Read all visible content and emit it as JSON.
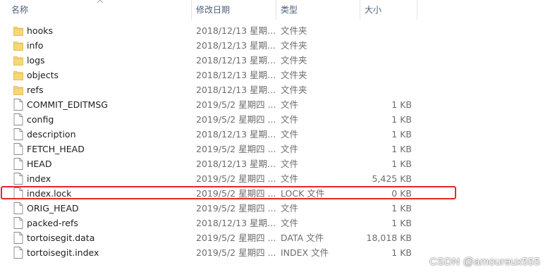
{
  "columns": {
    "name": "名称",
    "date": "修改日期",
    "type": "类型",
    "size": "大小"
  },
  "sort_indicator": "chevron-up-icon",
  "files": [
    {
      "name": "hooks",
      "date": "2018/12/13 星期...",
      "type": "文件夹",
      "size": "",
      "kind": "folder"
    },
    {
      "name": "info",
      "date": "2018/12/13 星期...",
      "type": "文件夹",
      "size": "",
      "kind": "folder"
    },
    {
      "name": "logs",
      "date": "2018/12/13 星期...",
      "type": "文件夹",
      "size": "",
      "kind": "folder"
    },
    {
      "name": "objects",
      "date": "2018/12/13 星期...",
      "type": "文件夹",
      "size": "",
      "kind": "folder"
    },
    {
      "name": "refs",
      "date": "2018/12/13 星期...",
      "type": "文件夹",
      "size": "",
      "kind": "folder"
    },
    {
      "name": "COMMIT_EDITMSG",
      "date": "2019/5/2 星期四 ...",
      "type": "文件",
      "size": "1 KB",
      "kind": "file"
    },
    {
      "name": "config",
      "date": "2019/5/2 星期四 ...",
      "type": "文件",
      "size": "1 KB",
      "kind": "file"
    },
    {
      "name": "description",
      "date": "2018/12/13 星期...",
      "type": "文件",
      "size": "1 KB",
      "kind": "file"
    },
    {
      "name": "FETCH_HEAD",
      "date": "2019/5/2 星期四 ...",
      "type": "文件",
      "size": "1 KB",
      "kind": "file"
    },
    {
      "name": "HEAD",
      "date": "2018/12/13 星期...",
      "type": "文件",
      "size": "1 KB",
      "kind": "file"
    },
    {
      "name": "index",
      "date": "2019/5/2 星期四 ...",
      "type": "文件",
      "size": "5,425 KB",
      "kind": "file"
    },
    {
      "name": "index.lock",
      "date": "2019/5/2 星期四 ...",
      "type": "LOCK 文件",
      "size": "0 KB",
      "kind": "file"
    },
    {
      "name": "ORIG_HEAD",
      "date": "2019/5/2 星期四 ...",
      "type": "文件",
      "size": "1 KB",
      "kind": "file"
    },
    {
      "name": "packed-refs",
      "date": "2018/12/13 星期...",
      "type": "文件",
      "size": "1 KB",
      "kind": "file"
    },
    {
      "name": "tortoisegit.data",
      "date": "2019/5/2 星期四 ...",
      "type": "DATA 文件",
      "size": "18,018 KB",
      "kind": "file"
    },
    {
      "name": "tortoisegit.index",
      "date": "2019/5/2 星期四 ...",
      "type": "INDEX 文件",
      "size": "1 KB",
      "kind": "file"
    }
  ],
  "highlight_color": "#e8262c",
  "folder_color": "#f8d775",
  "watermark": "CSDN @amoureux555"
}
